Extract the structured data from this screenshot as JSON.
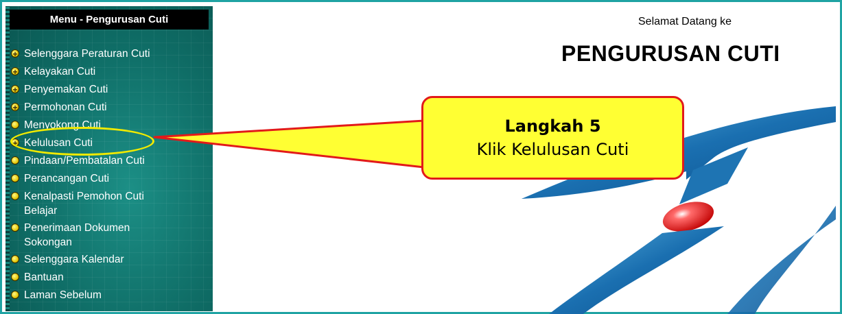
{
  "menu": {
    "title": "Menu - Pengurusan Cuti",
    "items": [
      {
        "label": "Selenggara Peraturan Cuti"
      },
      {
        "label": "Kelayakan Cuti"
      },
      {
        "label": "Penyemakan Cuti"
      },
      {
        "label": "Permohonan Cuti"
      },
      {
        "label": "Menyokong Cuti"
      },
      {
        "label": "Kelulusan Cuti"
      },
      {
        "label": "Pindaan/Pembatalan Cuti"
      },
      {
        "label": "Perancangan Cuti"
      },
      {
        "label_line1": "Kenalpasti Pemohon Cuti",
        "label_line2": "Belajar"
      },
      {
        "label_line1": "Penerimaan Dokumen",
        "label_line2": "Sokongan"
      },
      {
        "label": "Selenggara Kalendar"
      },
      {
        "label": "Bantuan"
      },
      {
        "label": "Laman Sebelum"
      }
    ]
  },
  "header": {
    "welcome": "Selamat Datang ke",
    "title": "PENGURUSAN CUTI"
  },
  "callout": {
    "step": "Langkah 5",
    "instruction": "Klik Kelulusan Cuti"
  },
  "colors": {
    "sidebar": "#0f6d66",
    "frame": "#1fa3a3",
    "callout_fill": "#ffff33",
    "callout_border": "#e21a1a",
    "highlight": "#f1ea00",
    "logo_blue": "#1a6fb0",
    "logo_red": "#e01818"
  },
  "icons": {
    "menu_bullet": "yellow-circle-bullet-icon",
    "logo": "swoosh-logo-icon"
  }
}
